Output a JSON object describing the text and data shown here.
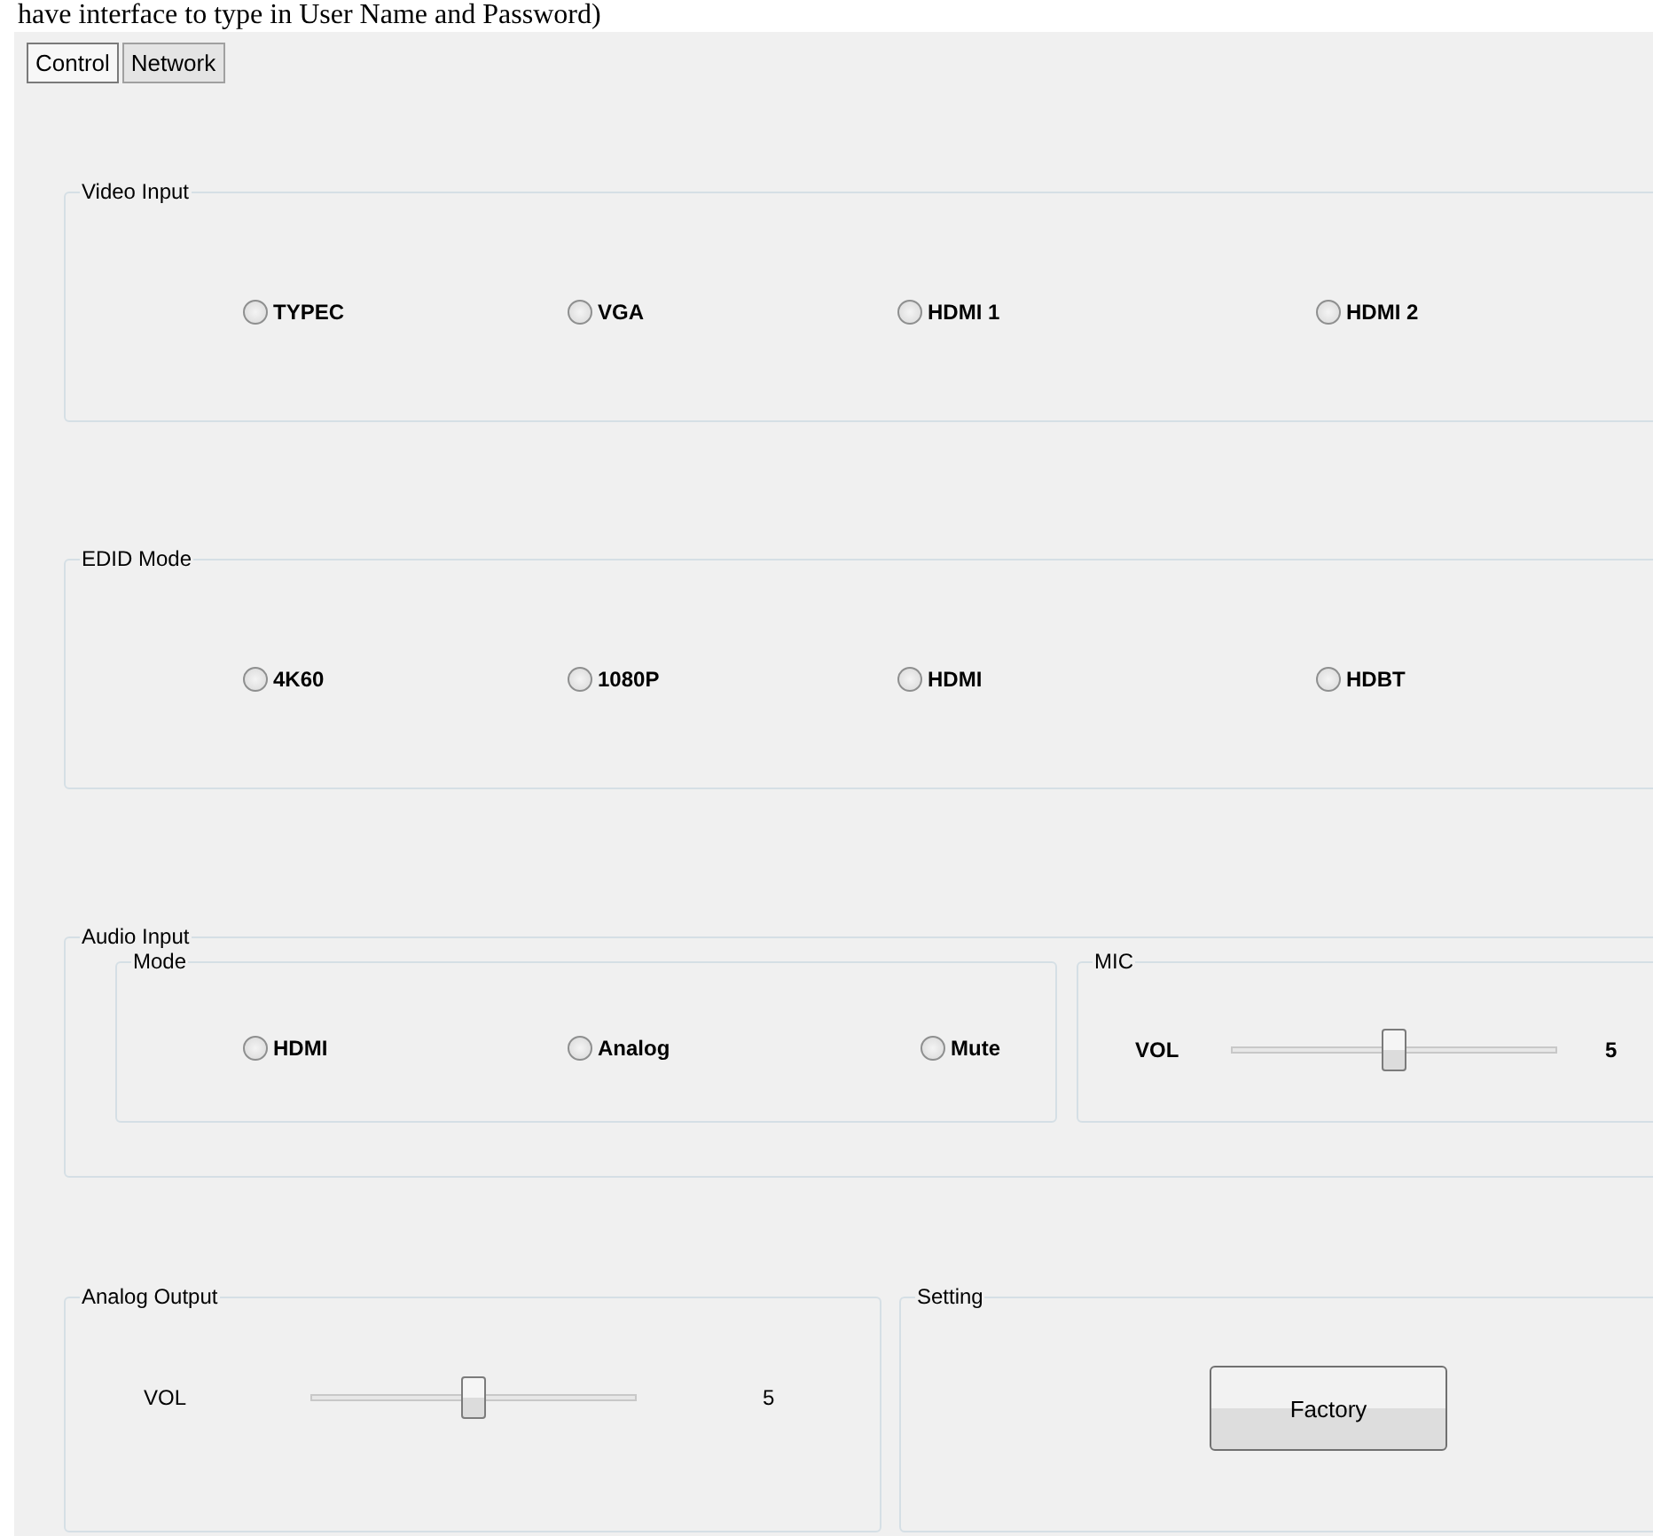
{
  "caption": "have interface to type in User Name and Password)",
  "tabs": [
    {
      "label": "Control",
      "selected": true
    },
    {
      "label": "Network",
      "selected": false
    }
  ],
  "video_input": {
    "title": "Video Input",
    "options": [
      {
        "label": "TYPEC",
        "selected": false
      },
      {
        "label": "VGA",
        "selected": false
      },
      {
        "label": "HDMI 1",
        "selected": false
      },
      {
        "label": "HDMI 2",
        "selected": false
      }
    ]
  },
  "edid_mode": {
    "title": "EDID Mode",
    "options": [
      {
        "label": "4K60",
        "selected": false
      },
      {
        "label": "1080P",
        "selected": false
      },
      {
        "label": "HDMI",
        "selected": false
      },
      {
        "label": "HDBT",
        "selected": false
      }
    ]
  },
  "audio_input": {
    "title": "Audio Input",
    "mode": {
      "title": "Mode",
      "options": [
        {
          "label": "HDMI",
          "selected": false
        },
        {
          "label": "Analog",
          "selected": false
        },
        {
          "label": "Mute",
          "selected": false
        }
      ]
    },
    "mic": {
      "title": "MIC",
      "label": "VOL",
      "level": 0.5,
      "reading": "5"
    }
  },
  "analog_output": {
    "title": "Analog Output",
    "label": "VOL",
    "level": 0.5,
    "reading": "5"
  },
  "setting": {
    "title": "Setting",
    "button": "Factory"
  }
}
